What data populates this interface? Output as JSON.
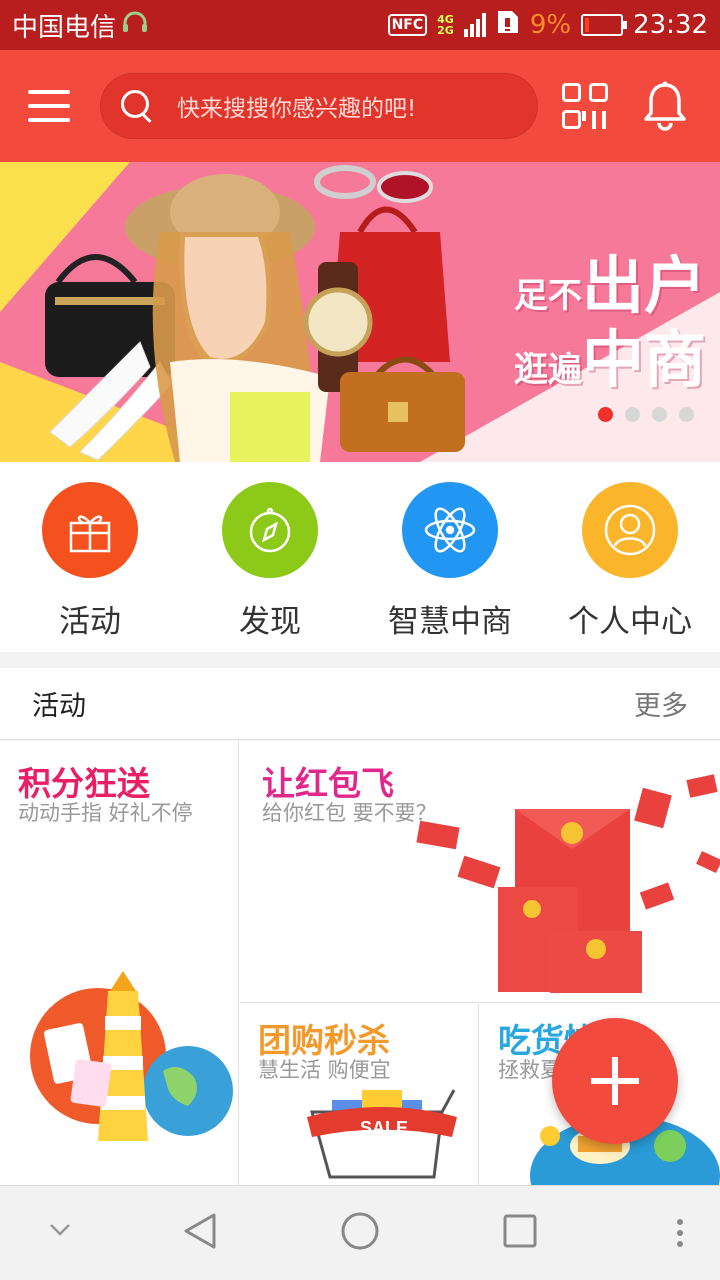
{
  "status_bar": {
    "carrier": "中国电信",
    "nfc_label": "NFC",
    "network_top": "4G",
    "network_bottom": "2G",
    "battery_percent": "9%",
    "battery_level": 0.09,
    "time": "23:32"
  },
  "header": {
    "search_placeholder": "快来搜搜你感兴趣的吧!",
    "icons": [
      "menu-icon",
      "search-icon",
      "qr-code-icon",
      "bell-icon"
    ]
  },
  "banner": {
    "slogan_line1_small": "足不",
    "slogan_line1_big": "出户",
    "slogan_line2_small": "逛遍",
    "slogan_line2_big": "中商",
    "slide_count": 4,
    "active_slide": 1
  },
  "quick_nav": [
    {
      "label": "活动",
      "icon": "gift-icon",
      "color": "#f4511e"
    },
    {
      "label": "发现",
      "icon": "compass-icon",
      "color": "#8cc918"
    },
    {
      "label": "智慧中商",
      "icon": "atom-icon",
      "color": "#2196f3"
    },
    {
      "label": "个人中心",
      "icon": "user-icon",
      "color": "#fbb52b"
    }
  ],
  "section": {
    "title": "活动",
    "more": "更多"
  },
  "cards": [
    {
      "title": "积分狂送",
      "subtitle": "动动手指  好礼不停",
      "color": "#e91e63"
    },
    {
      "title": "让红包飞",
      "subtitle": "给你红包    要不要？",
      "color": "#e0288c"
    },
    {
      "title": "团购秒杀",
      "subtitle": "慧生活 购便宜",
      "color": "#f29b2c"
    },
    {
      "title": "吃货快",
      "subtitle": "拯救夏",
      "color": "#29a8e0"
    }
  ],
  "fab": {
    "icon": "plus-icon"
  },
  "colors": {
    "primary": "#f24a3d",
    "status_bar": "#b81e1e"
  }
}
